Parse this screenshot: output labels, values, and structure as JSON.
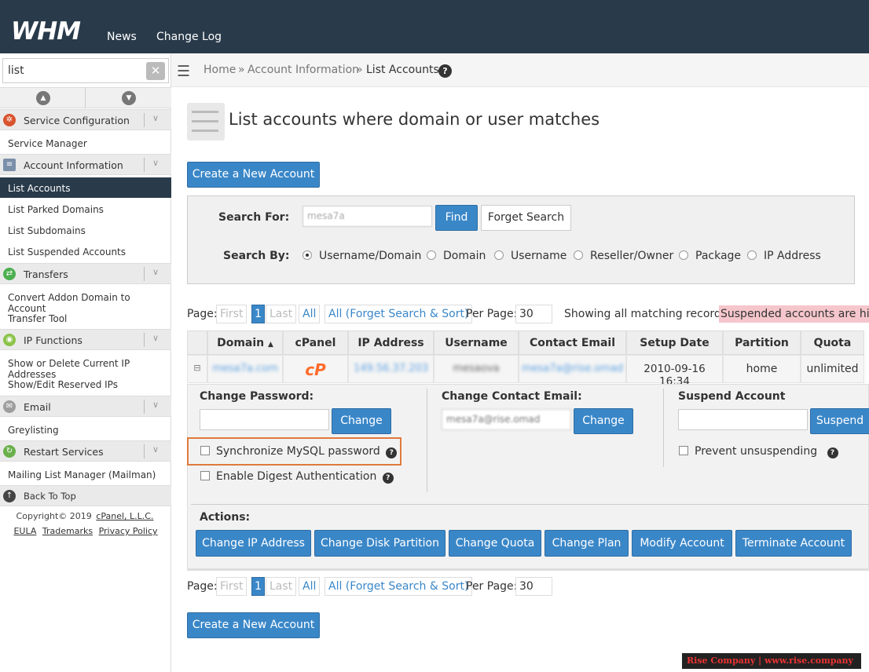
{
  "header": {
    "logo": "WHM",
    "nav": [
      "News",
      "Change Log"
    ]
  },
  "sidebar": {
    "search_value": "list",
    "sections": [
      {
        "label": "Service Configuration",
        "icon": "service-config-icon",
        "items": [
          "Service Manager"
        ]
      },
      {
        "label": "Account Information",
        "icon": "account-info-icon",
        "items": [
          "List Accounts",
          "List Parked Domains",
          "List Subdomains",
          "List Suspended Accounts"
        ]
      },
      {
        "label": "Transfers",
        "icon": "transfers-icon",
        "items": [
          "Convert Addon Domain to Account",
          "Transfer Tool"
        ]
      },
      {
        "label": "IP Functions",
        "icon": "ip-functions-icon",
        "items": [
          "Show or Delete Current IP Addresses",
          "Show/Edit Reserved IPs"
        ]
      },
      {
        "label": "Email",
        "icon": "email-icon",
        "items": [
          "Greylisting"
        ]
      },
      {
        "label": "Restart Services",
        "icon": "restart-services-icon",
        "items": [
          "Mailing List Manager (Mailman)"
        ]
      }
    ],
    "back_to_top": "Back To Top",
    "copyright": "Copyright© 2019",
    "copyright_link": "cPanel, L.L.C.",
    "footer_links": [
      "EULA",
      "Trademarks",
      "Privacy Policy"
    ]
  },
  "breadcrumb": [
    "Home",
    "Account Information",
    "List Accounts"
  ],
  "page_title": "List accounts where domain or user matches",
  "create_button": "Create a New Account",
  "search": {
    "search_for_label": "Search For:",
    "search_value": "mesa7a",
    "find_button": "Find",
    "forget_button": "Forget Search",
    "search_by_label": "Search By:",
    "options": [
      "Username/Domain",
      "Domain",
      "Username",
      "Reseller/Owner",
      "Package",
      "IP Address"
    ],
    "selected": "Username/Domain"
  },
  "pagination": {
    "page_label": "Page:",
    "first": "First",
    "current": "1",
    "last": "Last",
    "all": "All",
    "all_forget": "All (Forget Search & Sort)",
    "per_page_label": "Per Page:",
    "per_page": "30",
    "showing": "Showing all matching records.",
    "suspended_notice": "Suspended accounts are high"
  },
  "table": {
    "columns": [
      "Domain",
      "cPanel",
      "IP Address",
      "Username",
      "Contact Email",
      "Setup Date",
      "Partition",
      "Quota"
    ],
    "sorted_column_indicator": "▲",
    "row": {
      "expand": "⊟",
      "domain": "mesa7a.com",
      "cpanel": "cP",
      "ip": "149.56.37.203",
      "username": "mesaova",
      "email": "mesa7a@rise.omad",
      "setup_date": "2010-09-16 16:34",
      "partition": "home",
      "quota": "unlimited"
    }
  },
  "details": {
    "change_password_label": "Change Password:",
    "change_button": "Change",
    "sync_mysql": "Synchronize MySQL password",
    "digest_auth": "Enable Digest Authentication",
    "change_email_label": "Change Contact Email:",
    "email_value": "mesa7a@rise.omad",
    "change_email_button": "Change",
    "suspend_label": "Suspend Account",
    "suspend_button": "Suspend",
    "prevent_unsuspending": "Prevent unsuspending",
    "actions_label": "Actions:",
    "actions": [
      "Change IP Address",
      "Change Disk Partition",
      "Change Quota",
      "Change Plan",
      "Modify Account",
      "Terminate Account"
    ]
  },
  "watermark": "Rise Company | www.rise.company",
  "colors": {
    "header_bg": "#293a4a",
    "primary_button": "#3a87c8",
    "highlight_box": "#e07a3c",
    "suspended_bg": "#f5c6cb"
  }
}
